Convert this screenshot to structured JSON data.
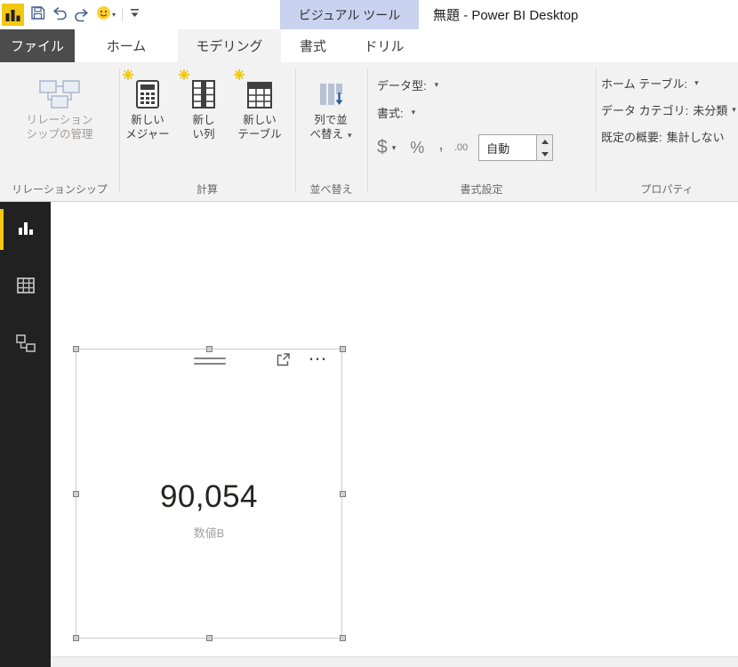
{
  "colors": {
    "accent_yellow": "#f2c811",
    "contextual_tab_bg": "#c9d2ee",
    "sidebar_bg": "#212121"
  },
  "icons": {
    "chevron_down": "▾",
    "ellipsis": "⋯"
  },
  "titlebar": {
    "app_title": "無題 - Power BI Desktop",
    "contextual_tab": "ビジュアル ツール"
  },
  "tabs": {
    "file": "ファイル",
    "home": "ホーム",
    "modeling": "モデリング",
    "format": "書式",
    "drill": "ドリル"
  },
  "ribbon": {
    "relationships": {
      "group_label": "リレーションシップ",
      "manage": "リレーション\nシップの管理"
    },
    "calc": {
      "group_label": "計算",
      "new_measure": "新しい\nメジャー",
      "new_column": "新し\nい列",
      "new_table": "新しい\nテーブル"
    },
    "sort": {
      "group_label": "並べ替え",
      "sort_by_column": "列で並\nべ替え"
    },
    "format": {
      "group_label": "書式設定",
      "data_type": "データ型:",
      "format": "書式:",
      "currency": "$",
      "percent": "%",
      "comma": ",",
      "decimals": ".00",
      "auto": "自動"
    },
    "props": {
      "group_label": "プロパティ",
      "home_table": "ホーム テーブル:",
      "data_category": "データ カテゴリ:",
      "data_category_value": "未分類",
      "default_summarization": "既定の概要:",
      "default_summarization_value": "集計しない"
    }
  },
  "card": {
    "value": "90,054",
    "caption": "数値B"
  }
}
